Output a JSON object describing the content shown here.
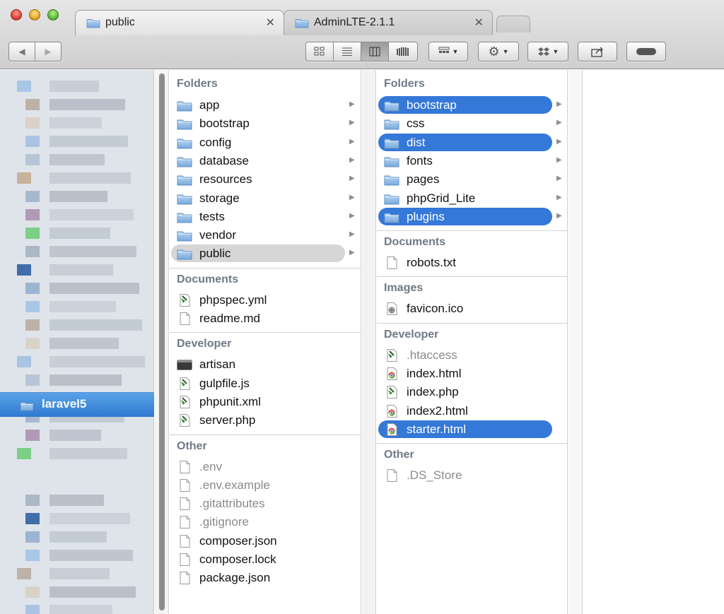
{
  "window": {
    "tabs": [
      {
        "label": "public",
        "close": "✕"
      },
      {
        "label": "AdminLTE-2.1.1",
        "close": "✕"
      }
    ]
  },
  "toolbar": {
    "back_label": "◀",
    "forward_label": "▶"
  },
  "sidebar": {
    "selected_label": "laravel5"
  },
  "column1": {
    "sections": {
      "folders": "Folders",
      "documents": "Documents",
      "developer": "Developer",
      "other": "Other"
    },
    "folders": [
      "app",
      "bootstrap",
      "config",
      "database",
      "resources",
      "storage",
      "tests",
      "vendor",
      "public"
    ],
    "documents": [
      "phpspec.yml",
      "readme.md"
    ],
    "developer": [
      "artisan",
      "gulpfile.js",
      "phpunit.xml",
      "server.php"
    ],
    "other": [
      ".env",
      ".env.example",
      ".gitattributes",
      ".gitignore",
      "composer.json",
      "composer.lock",
      "package.json"
    ]
  },
  "column2": {
    "sections": {
      "folders": "Folders",
      "documents": "Documents",
      "images": "Images",
      "developer": "Developer",
      "other": "Other"
    },
    "folders": [
      "bootstrap",
      "css",
      "dist",
      "fonts",
      "pages",
      "phpGrid_Lite",
      "plugins"
    ],
    "documents": [
      "robots.txt"
    ],
    "images": [
      "favicon.ico"
    ],
    "developer": [
      ".htaccess",
      "index.html",
      "index.php",
      "index2.html",
      "starter.html"
    ],
    "other": [
      ".DS_Store"
    ]
  },
  "colors": {
    "selection_blue": "#3478d8",
    "selection_gray": "#d6d6d6",
    "section_header": "#6e7a88",
    "folder_blue": "#8fbbe8",
    "sidebar_bg": "#dfe4ea"
  }
}
